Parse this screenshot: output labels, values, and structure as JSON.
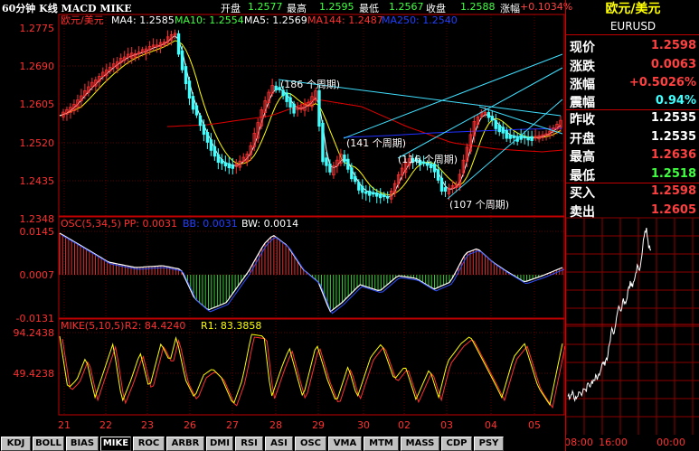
{
  "header": {
    "title": "60分钟 K线 MACD MIKE",
    "open_label": "开盘",
    "open_value": "1.2577",
    "high_label": "最高",
    "high_value": "1.2595",
    "low_label": "最低",
    "low_value": "1.2567",
    "close_label": "收盘",
    "close_value": "1.2588",
    "change_label": "涨幅",
    "change_value": "+0.1034%"
  },
  "main_chart": {
    "symbol": "欧元/美元",
    "ma4": "MA4: 1.2585",
    "ma10": "MA10: 1.2554",
    "ma5": "MA5: 1.2569",
    "ma144": "MA144: 1.2487",
    "ma250": "MA250: 1.2540",
    "yticks": [
      "1.2775",
      "1.2690",
      "1.2605",
      "1.2520",
      "1.2435",
      "1.2348"
    ],
    "annotations": [
      "(186 个周期)",
      "(141 个周期)",
      "(116 个周期)",
      "(107 个周期)"
    ]
  },
  "osc_chart": {
    "label": "OSC(5,34,5)",
    "pp": "PP: 0.0031",
    "bb": "BB: 0.0031",
    "bw": "BW: 0.0014",
    "yticks": [
      "0.0145",
      "0.0007",
      "-0.0131"
    ]
  },
  "mike_chart": {
    "label": "MIKE(5,10,5)",
    "r2": "R2: 84.4240",
    "r1": "R1: 83.3858",
    "yticks": [
      "94.2438",
      "49.4238"
    ]
  },
  "x_axis": [
    "21",
    "22",
    "23",
    "26",
    "27",
    "28",
    "29",
    "30",
    "02",
    "03",
    "04",
    "05"
  ],
  "tabs": [
    "KDJ",
    "BOLL",
    "BIAS",
    "MIKE",
    "ROC",
    "ARBR",
    "DMI",
    "RSI",
    "ASI",
    "OSC",
    "VMA",
    "MTM",
    "MASS",
    "CDP",
    "PSY"
  ],
  "active_tab": "MIKE",
  "quote": {
    "name": "欧元/美元",
    "code": "EURUSD",
    "rows": [
      {
        "label": "现价",
        "value": "1.2598",
        "color": "#ff4040"
      },
      {
        "label": "涨跌",
        "value": "0.0063",
        "color": "#ff4040"
      },
      {
        "label": "涨幅",
        "value": "+0.5026%",
        "color": "#ff4040"
      },
      {
        "label": "震幅",
        "value": "0.94%",
        "color": "#40ffff"
      },
      {
        "label": "昨收",
        "value": "1.2535",
        "color": "#ffffff"
      },
      {
        "label": "开盘",
        "value": "1.2535",
        "color": "#ffffff"
      },
      {
        "label": "最高",
        "value": "1.2636",
        "color": "#ff4040"
      },
      {
        "label": "最低",
        "value": "1.2518",
        "color": "#40ff40"
      },
      {
        "label": "买入",
        "value": "1.2598",
        "color": "#ff4040"
      },
      {
        "label": "卖出",
        "value": "1.2605",
        "color": "#ff4040"
      }
    ]
  },
  "intraday": {
    "x_labels": [
      "08:00",
      "16:00",
      "00:00"
    ],
    "series": [
      0.18,
      0.17,
      0.19,
      0.16,
      0.18,
      0.2,
      0.19,
      0.22,
      0.21,
      0.24,
      0.23,
      0.25,
      0.27,
      0.26,
      0.3,
      0.34,
      0.33,
      0.36,
      0.42,
      0.5,
      0.48,
      0.55,
      0.6,
      0.58,
      0.64,
      0.62,
      0.68,
      0.72,
      0.7,
      0.75,
      0.8,
      0.78,
      0.86,
      0.95,
      0.99,
      0.9,
      0.88
    ]
  },
  "colors": {
    "up": "#ff3030",
    "down": "#40ffff",
    "ma4": "#ffffff",
    "ma10": "#ffff00",
    "ma144": "#e00000",
    "ma250": "#2030ff",
    "grid": "#8b0000"
  }
}
